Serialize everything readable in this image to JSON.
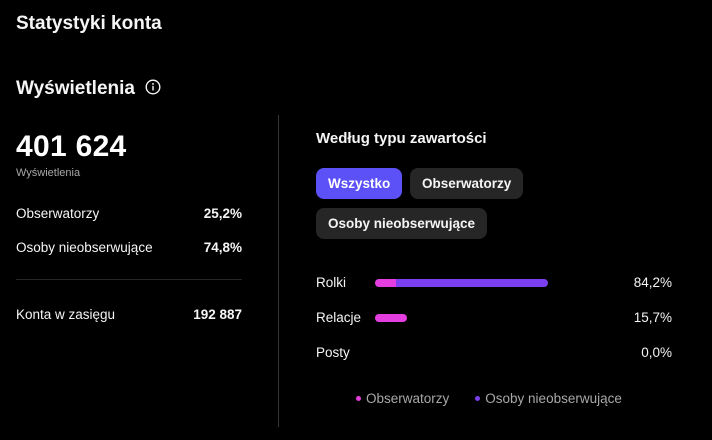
{
  "page": {
    "title": "Statystyki konta"
  },
  "views": {
    "section_title": "Wyświetlenia",
    "total": "401 624",
    "total_label": "Wyświetlenia",
    "followers_label": "Obserwatorzy",
    "followers_value": "25,2%",
    "nonfollowers_label": "Osoby nieobserwujące",
    "nonfollowers_value": "74,8%",
    "reach_label": "Konta w zasięgu",
    "reach_value": "192 887"
  },
  "content_type": {
    "title": "Według typu zawartości",
    "filters": {
      "all": "Wszystko",
      "followers": "Obserwatorzy",
      "nonfollowers": "Osoby nieobserwujące",
      "selected": "Wszystko"
    },
    "rows": [
      {
        "label": "Rolki",
        "percent": "84,2%",
        "share": 0.842,
        "followers_share": 0.12
      },
      {
        "label": "Relacje",
        "percent": "15,7%",
        "share": 0.157,
        "followers_share": 1.0
      },
      {
        "label": "Posty",
        "percent": "0,0%",
        "share": 0.0,
        "followers_share": 0.0
      }
    ],
    "legend": {
      "followers": "Obserwatorzy",
      "nonfollowers": "Osoby nieobserwujące"
    }
  },
  "colors": {
    "accent": "#5b51f6",
    "followers": "#e53ee0",
    "nonfollowers": "#7b3ff0"
  }
}
